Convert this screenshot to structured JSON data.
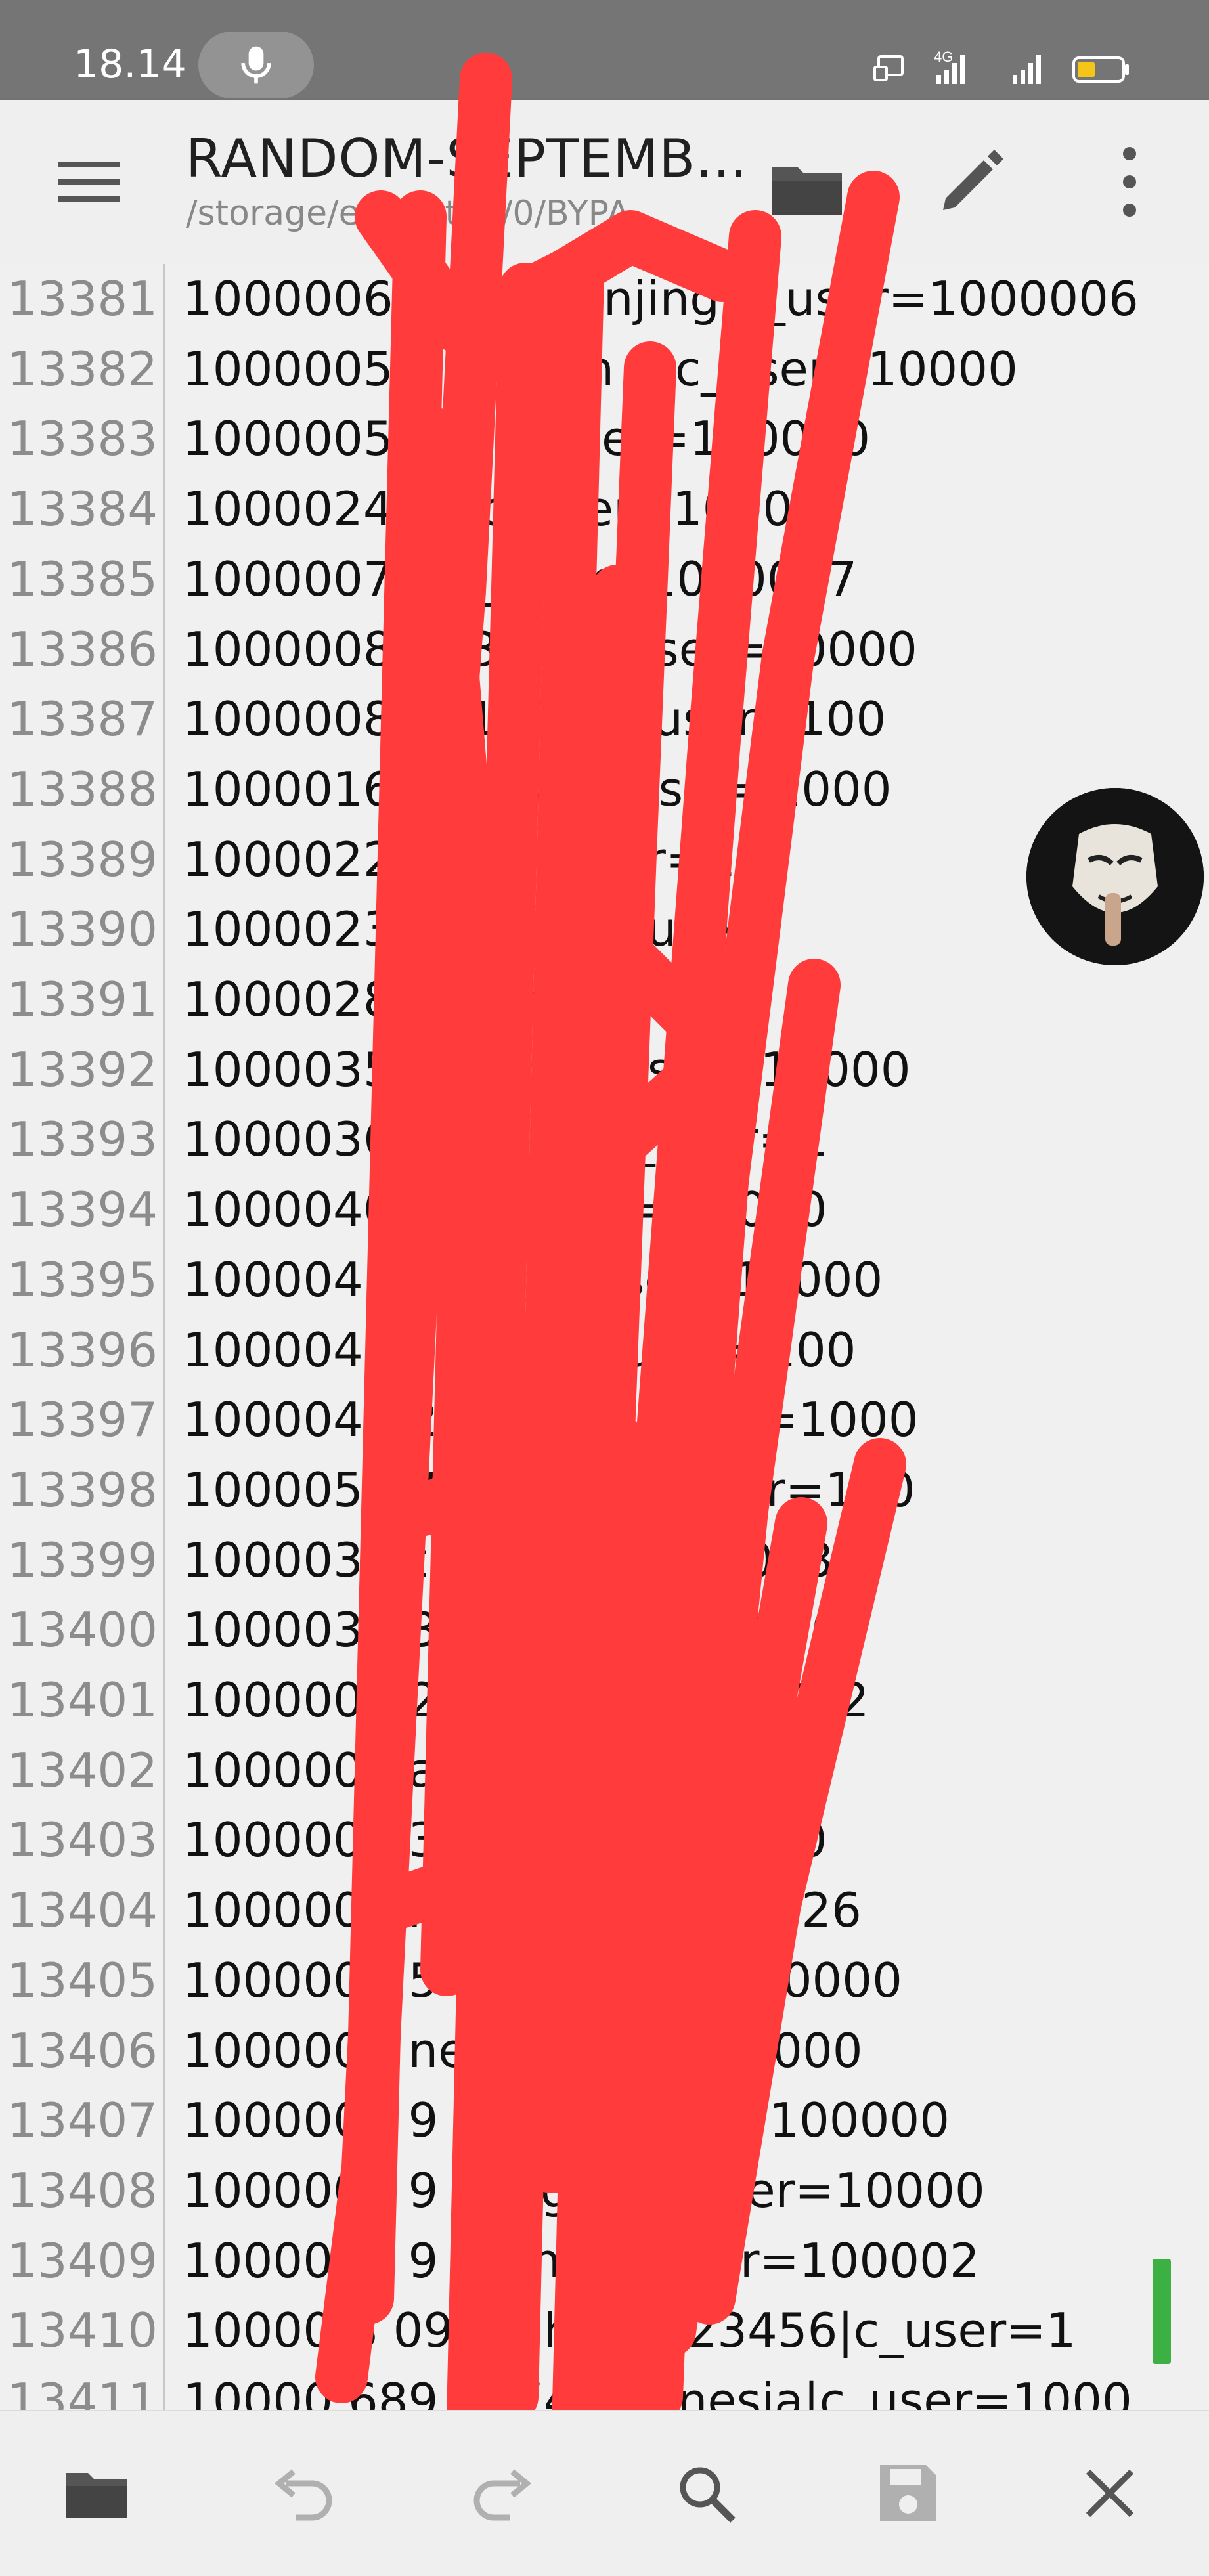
{
  "status_bar": {
    "time": "18.14",
    "network_label": "4G",
    "icons": [
      "mic-icon",
      "screen-mirror-icon",
      "signal-4g-icon",
      "signal-icon",
      "battery-low-icon"
    ],
    "battery_color": "#f5c518"
  },
  "app_bar": {
    "title": "RANDOM-SEPTEMB...",
    "path": "/storage/emulated/0/BYPA...",
    "icons": [
      "menu-icon",
      "open-folder-icon",
      "edit-pencil-icon",
      "more-vert-icon"
    ]
  },
  "editor": {
    "lines": [
      {
        "num": "13381",
        "text": "1000006  5 83 1|anjing|c_user=1000006"
      },
      {
        "num": "13382",
        "text": "1000005  2 3   7|s      n  u|c_user=10000"
      },
      {
        "num": "13383",
        "text": "1000005    0        a     c_user=100000"
      },
      {
        "num": "13384",
        "text": "1000024              ku|c_user=10000"
      },
      {
        "num": "13385",
        "text": "1000007             g|c_user=1000007"
      },
      {
        "num": "13386",
        "text": "1000008            12345|c_user=10000"
      },
      {
        "num": "13387",
        "text": "1000008           an1234|c_user=100"
      },
      {
        "num": "13388",
        "text": "1000016          onesia|c_user=1000"
      },
      {
        "num": "13389",
        "text": "1000022           ang|c_user=1"
      },
      {
        "num": "13390",
        "text": "1000023          yangku|c_use"
      },
      {
        "num": "13391",
        "text": "1000028          k  t  ndi|c_user="
      },
      {
        "num": "13392",
        "text": "1000035          b  s    ah|c_user=10000"
      },
      {
        "num": "13393",
        "text": "1000036          |       23456|c_user=1"
      },
      {
        "num": "13394",
        "text": "1000040            23|c_user=10000"
      },
      {
        "num": "13395",
        "text": "1000045           ngku|c_user=10000"
      },
      {
        "num": "13396",
        "text": "1000046          o1234|c_user=100"
      },
      {
        "num": "13397",
        "text": "1000049      2   angat|c_user=1000"
      },
      {
        "num": "13398",
        "text": "1000057      7   y123  5|c_user=100"
      },
      {
        "num": "13399",
        "text": "1000039          t  g  _user=100003"
      },
      {
        "num": "13400",
        "text": "1000038      3     2     c_user=10000"
      },
      {
        "num": "13401",
        "text": "1000002      2       y   c_user=100002"
      },
      {
        "num": "13402",
        "text": "1000001         a     2233|c_user=1"
      },
      {
        "num": "13403",
        "text": "1000004           34|c_user=10000"
      },
      {
        "num": "13404",
        "text": "1000002           r   |c_user=1000026"
      },
      {
        "num": "13405",
        "text": "1000003      5    234|c_user=10000"
      },
      {
        "num": "13406",
        "text": "1000002         nesia|c_user=1000"
      },
      {
        "num": "13407",
        "text": "1000000      9  tang|c_user=100000"
      },
      {
        "num": "13408",
        "text": "1000000      9  yangku|c_user=10000"
      },
      {
        "num": "13409",
        "text": "1000001  9    ntang|c_user=100002"
      },
      {
        "num": "13410",
        "text": "10000  8 09   13   hsan123456|c_user=1"
      },
      {
        "num": "13411",
        "text": "10000  689  2074  ndonesia|c_user=1000"
      }
    ],
    "scribble_color": "#ff3b3b",
    "scroll_handle_color": "#3cb043"
  },
  "bottom_bar": {
    "icons": [
      "open-folder-icon",
      "undo-icon",
      "redo-icon",
      "search-icon",
      "save-icon",
      "close-icon"
    ]
  },
  "overlay": {
    "avatar": "masked-avatar-icon"
  }
}
